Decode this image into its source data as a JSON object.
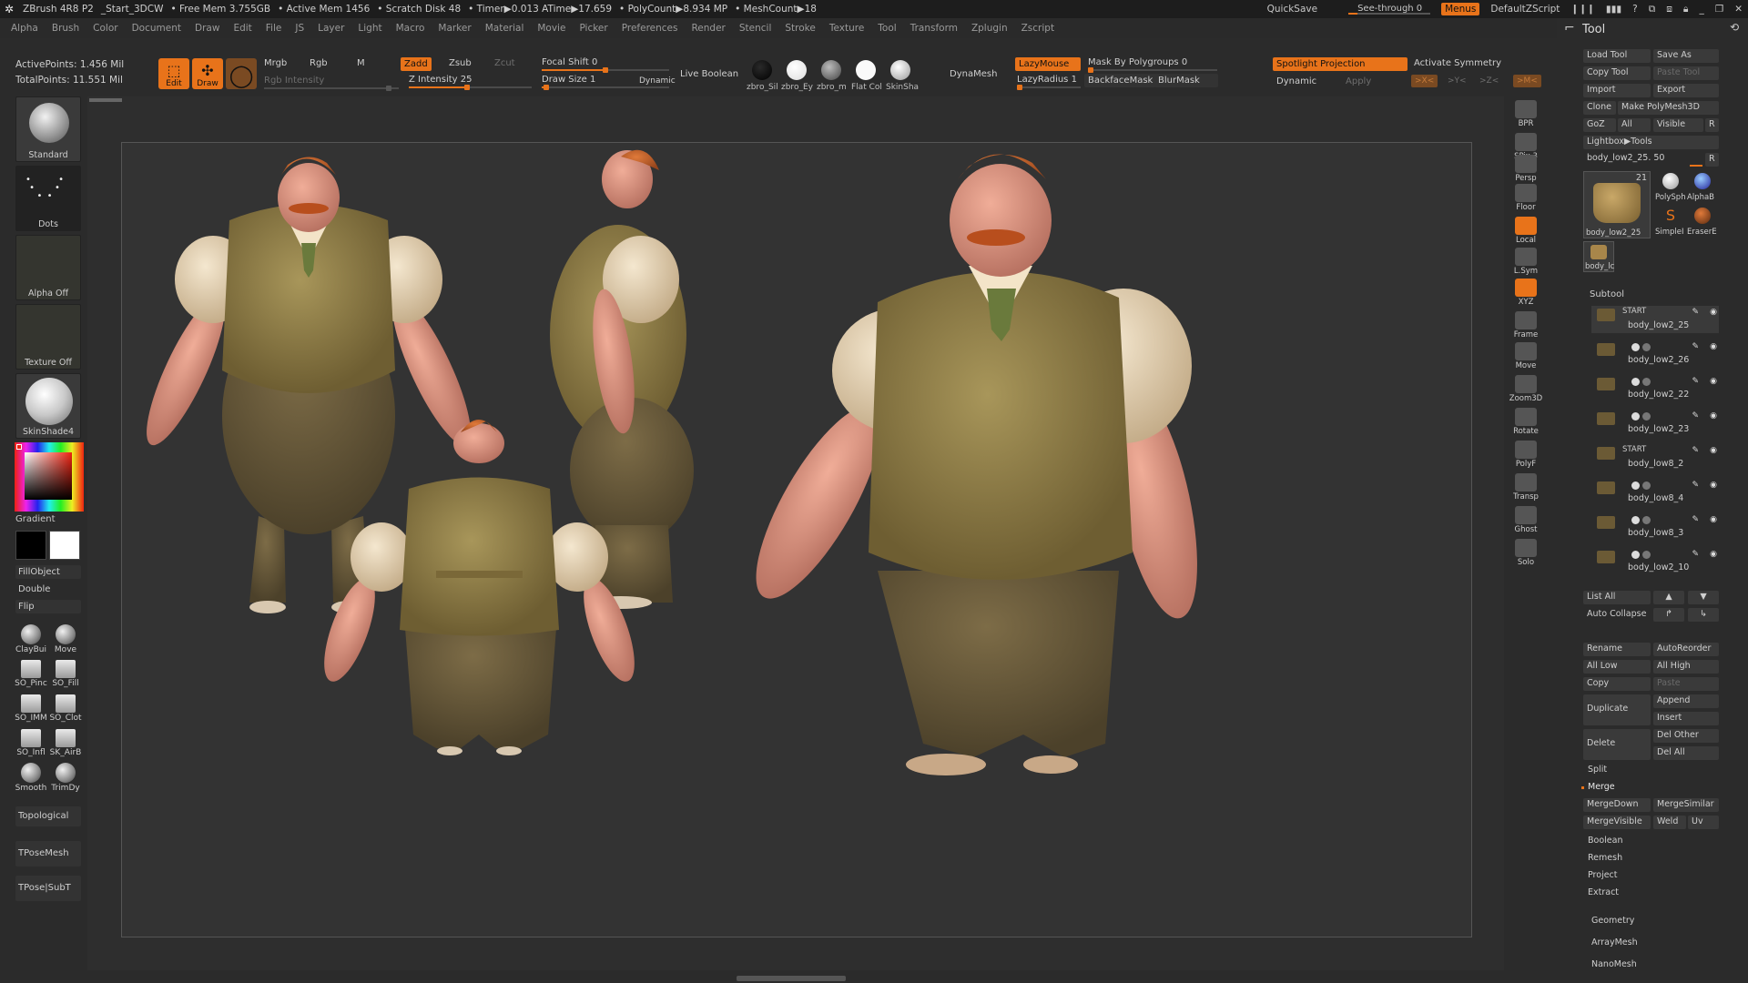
{
  "titlebar": {
    "app": "ZBrush 4R8 P2",
    "doc": "_Start_3DCW",
    "free_mem": "• Free Mem 3.755GB",
    "active_mem": "• Active Mem 1456",
    "scratch": "• Scratch Disk 48",
    "timer": "• Timer▶0.013 ATime▶17.659",
    "polycount": "• PolyCount▶8.934 MP",
    "meshcount": "• MeshCount▶18",
    "quicksave": "QuickSave",
    "seethrough": "See-through  0",
    "menus": "Menus",
    "script": "DefaultZScript"
  },
  "menubar": [
    "Alpha",
    "Brush",
    "Color",
    "Document",
    "Draw",
    "Edit",
    "File",
    "JS",
    "Layer",
    "Light",
    "Macro",
    "Marker",
    "Material",
    "Movie",
    "Picker",
    "Preferences",
    "Render",
    "Stencil",
    "Stroke",
    "Texture",
    "Tool",
    "Transform",
    "Zplugin",
    "Zscript"
  ],
  "topshelf": {
    "active_points": "ActivePoints: 1.456 Mil",
    "total_points": "TotalPoints: 11.551 Mil",
    "edit": "Edit",
    "draw": "Draw",
    "mrgb": "Mrgb",
    "rgb": "Rgb",
    "m": "M",
    "rgb_intensity": "Rgb Intensity",
    "zadd": "Zadd",
    "zsub": "Zsub",
    "zcut": "Zcut",
    "z_intensity": "Z Intensity 25",
    "focal_shift": "Focal Shift  0",
    "draw_size": "Draw Size  1",
    "dynamic": "Dynamic",
    "live_boolean": "Live Boolean",
    "materials": [
      "zbro_Sil",
      "zbro_Ey",
      "zbro_m",
      "Flat Col",
      "SkinSha"
    ],
    "dynamesh": "DynaMesh",
    "lazymouse": "LazyMouse",
    "lazyradius": "LazyRadius  1",
    "mask_polygroups": "Mask By Polygroups  0",
    "backface": "BackfaceMask",
    "blurmask": "BlurMask",
    "spotlight": "Spotlight Projection",
    "activate_symmetry": "Activate Symmetry",
    "dynamic2": "Dynamic",
    "apply": "Apply",
    "sym_x": ">X<",
    "sym_y": ">Y<",
    "sym_z": ">Z<",
    "sym_m": ">M<"
  },
  "leftshelf": {
    "brush": "Standard",
    "stroke": "Dots",
    "alpha": "Alpha Off",
    "texture": "Texture Off",
    "material": "SkinShade4",
    "gradient": "Gradient",
    "fillobject": "FillObject",
    "double": "Double",
    "flip": "Flip",
    "brushes": [
      "ClayBui",
      "Move",
      "SO_Pinc",
      "SO_Fill",
      "SO_IMM",
      "SO_Clot",
      "SO_Infl",
      "SK_AirB",
      "Smooth",
      "TrimDy"
    ],
    "topological": "Topological",
    "tposemesh": "TPoseMesh",
    "tposesubt": "TPose|SubT"
  },
  "rightstrip": [
    "BPR",
    "SPix 3",
    "Persp",
    "Floor",
    "Local",
    "L.Sym",
    "XYZ",
    "Frame",
    "Move",
    "Zoom3D",
    "Rotate",
    "PolyF",
    "Transp",
    "Ghost",
    "Solo"
  ],
  "toolpanel": {
    "title": "Tool",
    "load_tool": "Load Tool",
    "save_as": "Save As",
    "copy_tool": "Copy Tool",
    "paste_tool": "Paste Tool",
    "import": "Import",
    "export": "Export",
    "clone": "Clone",
    "make_polymesh": "Make PolyMesh3D",
    "goz": "GoZ",
    "all": "All",
    "visible": "Visible",
    "r": "R",
    "lightbox_tools": "Lightbox▶Tools",
    "current_tool": "body_low2_25. 50",
    "thumb_count": "21",
    "thumb_name": "body_low2_25",
    "polysphere": "PolySph",
    "alphab": "AlphaB",
    "simplebrush": "SimpleI",
    "eraserb": "EraserE",
    "small_thumb": "body_lc",
    "subtool_header": "Subtool",
    "subtools": [
      {
        "name": "body_low2_25",
        "tag": "START"
      },
      {
        "name": "body_low2_26",
        "tag": ""
      },
      {
        "name": "body_low2_22",
        "tag": ""
      },
      {
        "name": "body_low2_23",
        "tag": ""
      },
      {
        "name": "body_low8_2",
        "tag": "START"
      },
      {
        "name": "body_low8_4",
        "tag": ""
      },
      {
        "name": "body_low8_3",
        "tag": ""
      },
      {
        "name": "body_low2_10",
        "tag": ""
      }
    ],
    "list_all": "List All",
    "auto_collapse": "Auto Collapse",
    "rename": "Rename",
    "autoreorder": "AutoReorder",
    "all_low": "All Low",
    "all_high": "All High",
    "copy": "Copy",
    "paste": "Paste",
    "duplicate": "Duplicate",
    "append": "Append",
    "insert": "Insert",
    "delete": "Delete",
    "del_other": "Del Other",
    "del_all": "Del All",
    "split": "Split",
    "merge": "Merge",
    "mergedown": "MergeDown",
    "mergesimilar": "MergeSimilar",
    "mergevisible": "MergeVisible",
    "weld": "Weld",
    "uv": "Uv",
    "boolean": "Boolean",
    "remesh": "Remesh",
    "project": "Project",
    "extract": "Extract",
    "geometry": "Geometry",
    "arraymesh": "ArrayMesh",
    "nanomesh": "NanoMesh"
  }
}
